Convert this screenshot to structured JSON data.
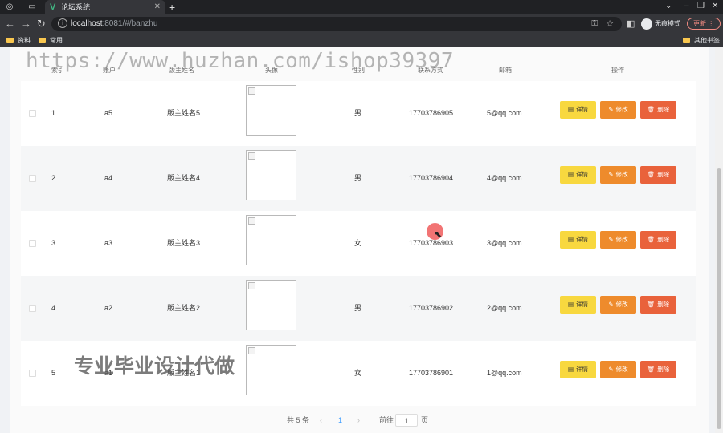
{
  "browser": {
    "tab_title": "论坛系统",
    "url_host": "localhost",
    "url_rest": ":8081/#/banzhu",
    "incognito_label": "无痕模式",
    "update_label": "更新",
    "bookmarks": [
      "资料",
      "常用"
    ],
    "bookmarks_right": "其他书签"
  },
  "table": {
    "headers": [
      "索引",
      "账户",
      "版主姓名",
      "头像",
      "性别",
      "联系方式",
      "邮箱",
      "操作"
    ],
    "rows": [
      {
        "index": "1",
        "account": "a5",
        "name": "版主姓名5",
        "gender": "男",
        "phone": "17703786905",
        "email": "5@qq.com"
      },
      {
        "index": "2",
        "account": "a4",
        "name": "版主姓名4",
        "gender": "男",
        "phone": "17703786904",
        "email": "4@qq.com"
      },
      {
        "index": "3",
        "account": "a3",
        "name": "版主姓名3",
        "gender": "女",
        "phone": "17703786903",
        "email": "3@qq.com"
      },
      {
        "index": "4",
        "account": "a2",
        "name": "版主姓名2",
        "gender": "男",
        "phone": "17703786902",
        "email": "2@qq.com"
      },
      {
        "index": "5",
        "account": "a1",
        "name": "版主姓名1",
        "gender": "女",
        "phone": "17703786901",
        "email": "1@qq.com"
      }
    ],
    "actions": {
      "detail": "详情",
      "edit": "修改",
      "delete": "删除"
    }
  },
  "pagination": {
    "total": "共 5 条",
    "prev": "‹",
    "current": "1",
    "next": "›",
    "goto_label": "前往",
    "goto_value": "1",
    "page_unit": "页"
  },
  "watermarks": {
    "url": "https://www.huzhan.com/ishop39397",
    "slogan": "专业毕业设计代做"
  },
  "colors": {
    "detail": "#f8d83f",
    "edit": "#ee8b2c",
    "delete": "#e9623b"
  }
}
